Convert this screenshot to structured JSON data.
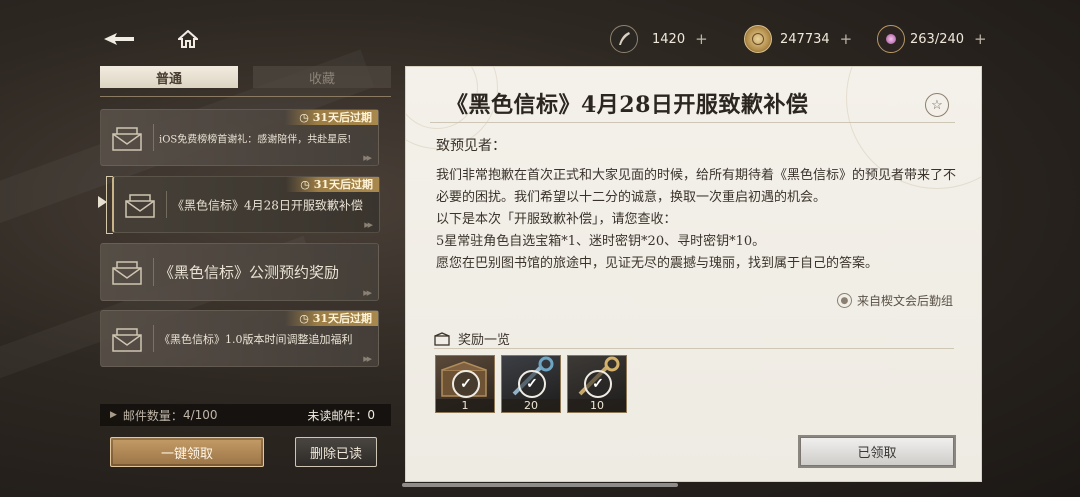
{
  "top_bar": {
    "resources": [
      {
        "icon": "quill-icon",
        "value": "1420",
        "plus": "+"
      },
      {
        "icon": "coin-icon",
        "value": "247734",
        "plus": "+"
      },
      {
        "icon": "energy-orb-icon",
        "value": "263/240",
        "plus": "+"
      }
    ]
  },
  "tabs": [
    {
      "label": "普通",
      "active": true
    },
    {
      "label": "收藏",
      "active": false
    }
  ],
  "mails": [
    {
      "title": "iOS免费榜榜首谢礼：感谢陪伴，共赴星辰!",
      "expiry": "31天后过期",
      "selected": false
    },
    {
      "title": "《黑色信标》4月28日开服致歉补偿",
      "expiry": "31天后过期",
      "selected": true
    },
    {
      "title": "《黑色信标》公测预约奖励",
      "expiry": "",
      "selected": false
    },
    {
      "title": "《黑色信标》1.0版本时间调整追加福利",
      "expiry": "31天后过期",
      "selected": false
    }
  ],
  "footer": {
    "mail_count_label": "邮件数量：",
    "mail_count": "4/100",
    "unread_label": "未读邮件：",
    "unread_count": "0",
    "claim_all": "一键领取",
    "delete_read": "删除已读"
  },
  "detail": {
    "title": "《黑色信标》4月28日开服致歉补偿",
    "greeting": "致预见者：",
    "paragraphs": [
      "我们非常抱歉在首次正式和大家见面的时候，给所有期待着《黑色信标》的预见者带来了不必要的困扰。我们希望以十二分的诚意，换取一次重启初遇的机会。",
      "以下是本次「开服致歉补偿」，请您查收：",
      "5星常驻角色自选宝箱*1、迷时密钥*20、寻时密钥*10。",
      "愿您在巴别图书馆的旅途中，见证无尽的震撼与瑰丽，找到属于自己的答案。"
    ],
    "sender": "来自楔文会后勤组",
    "rewards_label": "奖励一览",
    "rewards": [
      {
        "icon": "chest-icon",
        "qty": "1",
        "claimed": true
      },
      {
        "icon": "blue-key-icon",
        "qty": "20",
        "claimed": true
      },
      {
        "icon": "gold-key-icon",
        "qty": "10",
        "claimed": true
      }
    ],
    "claimed_label": "已领取"
  },
  "colors": {
    "expiry_badge": "#a8884c",
    "claim_button": "#b58a57",
    "panel_bg": "#f2efe8"
  }
}
